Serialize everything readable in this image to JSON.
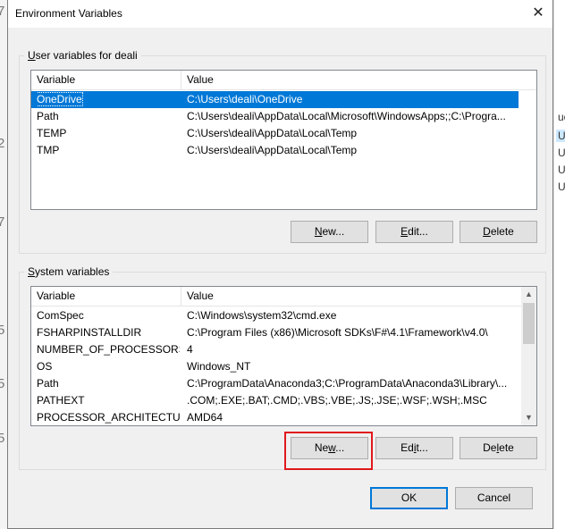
{
  "dialog": {
    "title": "Environment Variables",
    "close_glyph": "✕"
  },
  "user_vars": {
    "group_label_prefix": "U",
    "group_label_rest": "ser variables for deali",
    "columns": [
      "Variable",
      "Value"
    ],
    "rows": [
      {
        "name": "OneDrive",
        "value": "C:\\Users\\deali\\OneDrive",
        "selected": true
      },
      {
        "name": "Path",
        "value": "C:\\Users\\deali\\AppData\\Local\\Microsoft\\WindowsApps;;C:\\Progra..."
      },
      {
        "name": "TEMP",
        "value": "C:\\Users\\deali\\AppData\\Local\\Temp"
      },
      {
        "name": "TMP",
        "value": "C:\\Users\\deali\\AppData\\Local\\Temp"
      }
    ],
    "buttons": {
      "new_u": "N",
      "new_rest": "ew...",
      "edit_a": "",
      "edit_u": "E",
      "edit_rest": "dit...",
      "delete_a": "",
      "delete_u": "D",
      "delete_rest": "elete"
    }
  },
  "system_vars": {
    "group_label_prefix": "S",
    "group_label_rest": "ystem variables",
    "columns": [
      "Variable",
      "Value"
    ],
    "rows": [
      {
        "name": "ComSpec",
        "value": "C:\\Windows\\system32\\cmd.exe"
      },
      {
        "name": "FSHARPINSTALLDIR",
        "value": "C:\\Program Files (x86)\\Microsoft SDKs\\F#\\4.1\\Framework\\v4.0\\"
      },
      {
        "name": "NUMBER_OF_PROCESSORS",
        "value": "4"
      },
      {
        "name": "OS",
        "value": "Windows_NT"
      },
      {
        "name": "Path",
        "value": "C:\\ProgramData\\Anaconda3;C:\\ProgramData\\Anaconda3\\Library\\..."
      },
      {
        "name": "PATHEXT",
        "value": ".COM;.EXE;.BAT;.CMD;.VBS;.VBE;.JS;.JSE;.WSF;.WSH;.MSC"
      },
      {
        "name": "PROCESSOR_ARCHITECTURE",
        "value": "AMD64"
      }
    ],
    "buttons": {
      "new_a": "Ne",
      "new_u": "w",
      "new_rest": "...",
      "edit_a": "Ed",
      "edit_u": "i",
      "edit_rest": "t...",
      "delete_a": "De",
      "delete_u": "l",
      "delete_rest": "ete"
    }
  },
  "footer": {
    "ok_label": "OK",
    "cancel_label": "Cancel"
  },
  "background": {
    "left_glyphs": [
      "7",
      "2",
      "7",
      "5",
      "5",
      "5"
    ],
    "right_glyphs": [
      "ue",
      "U",
      "U",
      "U",
      "U"
    ]
  },
  "colors": {
    "selection": "#0078d7",
    "highlight": "#e0191c",
    "dialog_bg": "#f0f0f0"
  }
}
